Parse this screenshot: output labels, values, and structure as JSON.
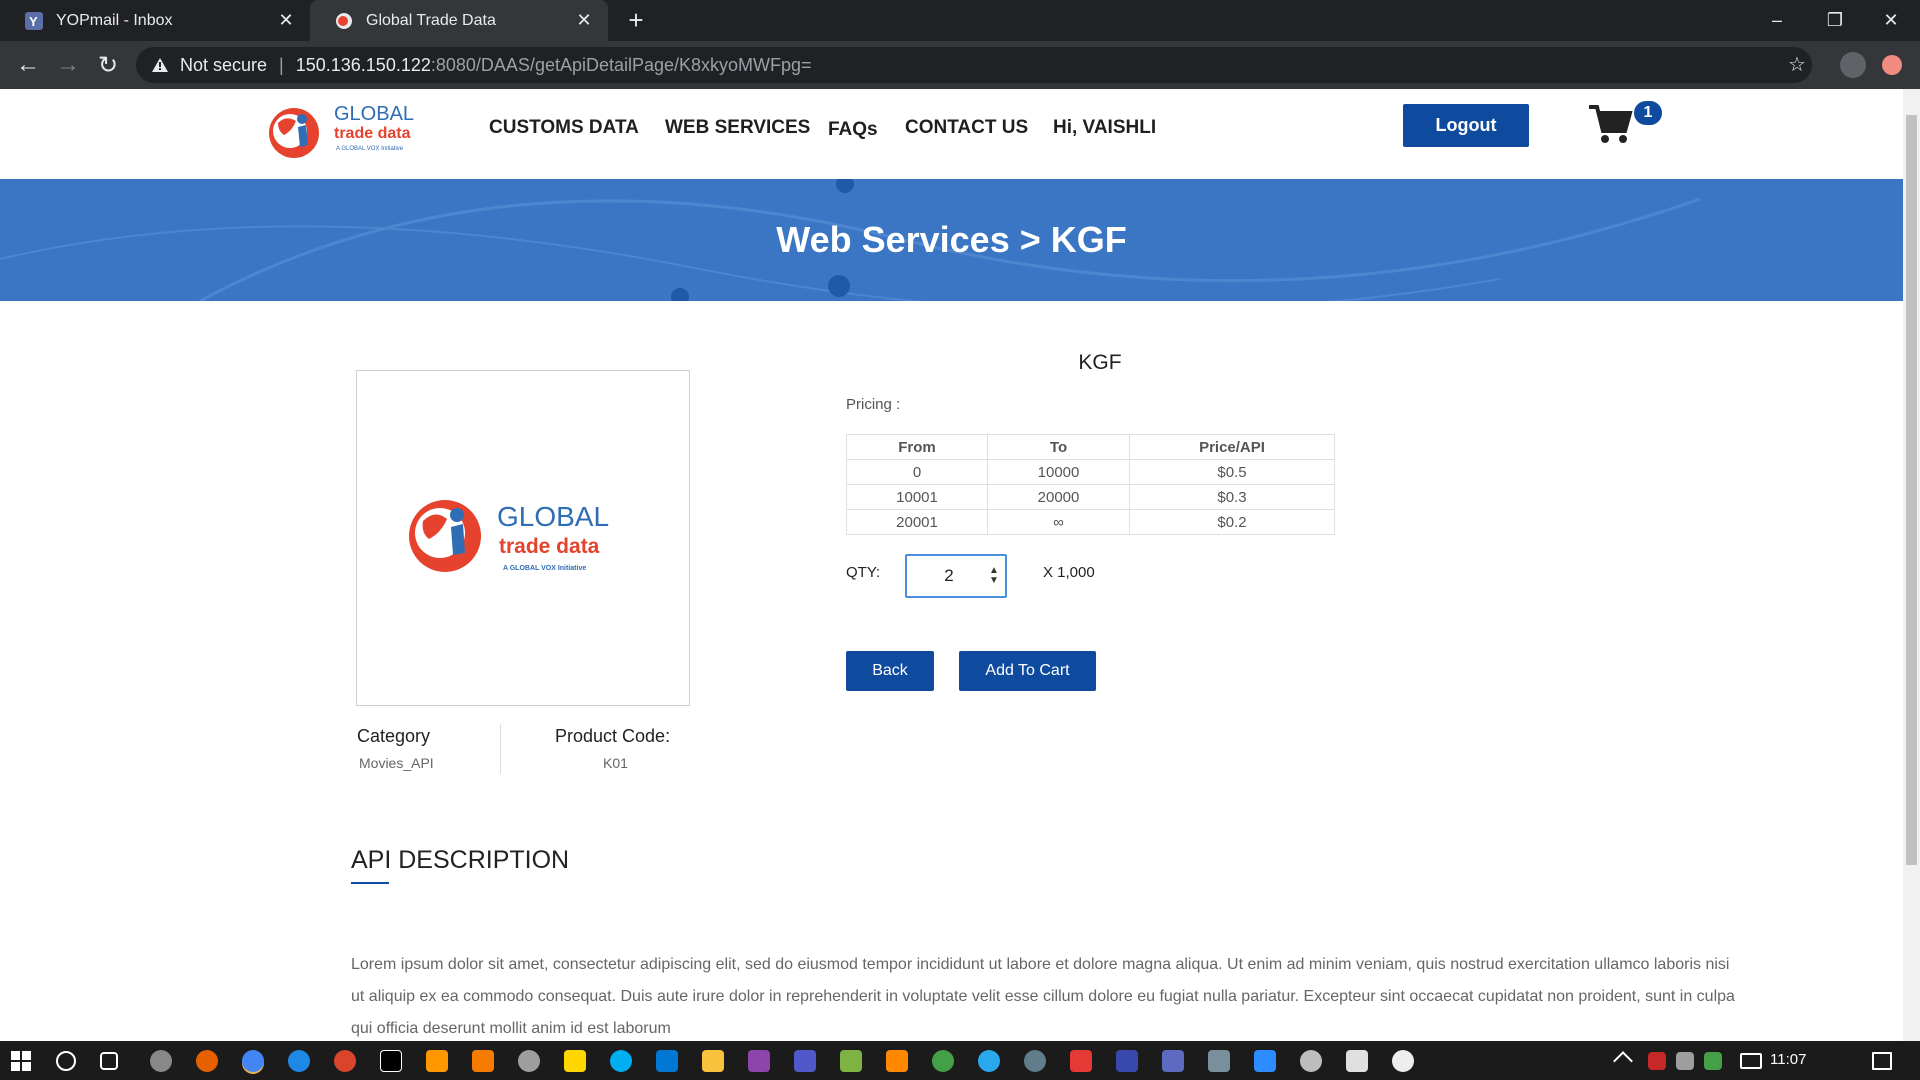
{
  "browser": {
    "tabs": [
      {
        "title": "YOPmail - Inbox"
      },
      {
        "title": "Global Trade Data"
      }
    ],
    "url": {
      "security": "Not secure",
      "host": "150.136.150.122",
      "path": ":8080/DAAS/getApiDetailPage/K8xkyoMWFpg="
    }
  },
  "site": {
    "nav": {
      "customs_data": "CUSTOMS DATA",
      "web_services": "WEB SERVICES",
      "faqs": "FAQs",
      "contact_us": "CONTACT US",
      "greeting": "Hi, VAISHLI"
    },
    "logout_label": "Logout",
    "cart_count": "1",
    "logo": {
      "line1": "GLOBAL",
      "line2": "trade data",
      "line3": "A GLOBAL VOX Initiative"
    }
  },
  "banner": {
    "title": "Web Services > KGF"
  },
  "product": {
    "title": "KGF",
    "category_label": "Category",
    "category_value": "Movies_API",
    "code_label": "Product Code:",
    "code_value": "K01",
    "pricing_label": "Pricing :",
    "pricing_headers": [
      "From",
      "To",
      "Price/API"
    ],
    "pricing_rows": [
      [
        "0",
        "10000",
        "$0.5"
      ],
      [
        "10001",
        "20000",
        "$0.3"
      ],
      [
        "20001",
        "∞",
        "$0.2"
      ]
    ],
    "qty_label": "QTY:",
    "qty_value": "2",
    "qty_multiplier": "X 1,000",
    "back_label": "Back",
    "add_to_cart_label": "Add To Cart"
  },
  "description": {
    "title": "API DESCRIPTION",
    "text": "Lorem ipsum dolor sit amet, consectetur adipiscing elit, sed do eiusmod tempor incididunt ut labore et dolore magna aliqua. Ut enim ad minim veniam, quis nostrud exercitation ullamco laboris nisi ut aliquip ex ea commodo consequat. Duis aute irure dolor in reprehenderit in voluptate velit esse cillum dolore eu fugiat nulla pariatur. Excepteur sint occaecat cupidatat non proident, sunt in culpa qui officia deserunt mollit anim id est laborum"
  },
  "taskbar": {
    "time": "11:07"
  },
  "colors": {
    "brand_blue": "#0e4a9e",
    "banner_blue": "#3a76c4",
    "chrome_dark": "#202124"
  }
}
